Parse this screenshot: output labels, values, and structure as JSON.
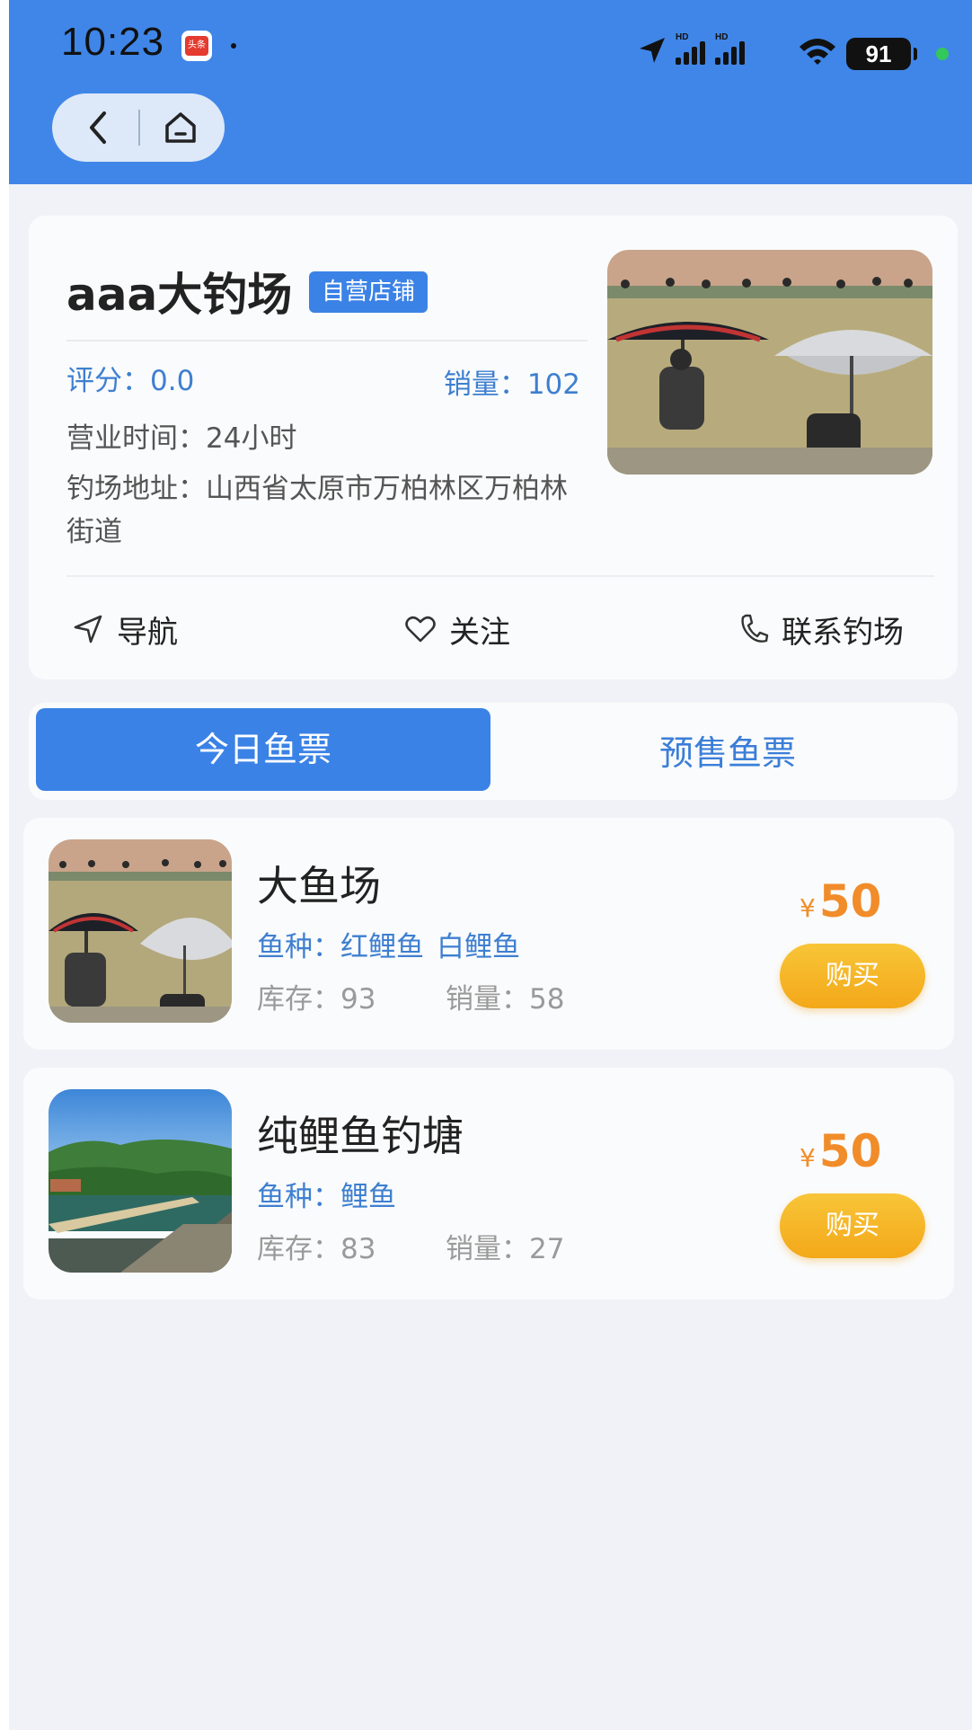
{
  "status_bar": {
    "time": "10:23",
    "app_badge": "头条",
    "battery": "91"
  },
  "shop": {
    "name": "aaa大钓场",
    "tag": "自营店铺",
    "rating": "评分：0.0",
    "sales": "销量：102",
    "hours": "营业时间：24小时",
    "address": "钓场地址：山西省太原市万柏林区万柏林街道",
    "actions": {
      "navigate": "导航",
      "follow": "关注",
      "contact": "联系钓场"
    }
  },
  "tabs": [
    {
      "label": "今日鱼票",
      "active": true
    },
    {
      "label": "预售鱼票",
      "active": false
    }
  ],
  "tickets": [
    {
      "name": "大鱼场",
      "species_label": "鱼种：",
      "species": [
        "红鲤鱼",
        "白鲤鱼"
      ],
      "stock": "库存：93",
      "sold": "销量：58",
      "currency": "¥",
      "price": "50",
      "buy": "购买"
    },
    {
      "name": "纯鲤鱼钓塘",
      "species_label": "鱼种：",
      "species": [
        "鲤鱼"
      ],
      "stock": "库存：83",
      "sold": "销量：27",
      "currency": "¥",
      "price": "50",
      "buy": "购买"
    }
  ],
  "colors": {
    "header": "#4086e8",
    "accent_blue": "#3b82e6",
    "price_orange": "#f18c2a",
    "buy_button": "#f5b625"
  }
}
